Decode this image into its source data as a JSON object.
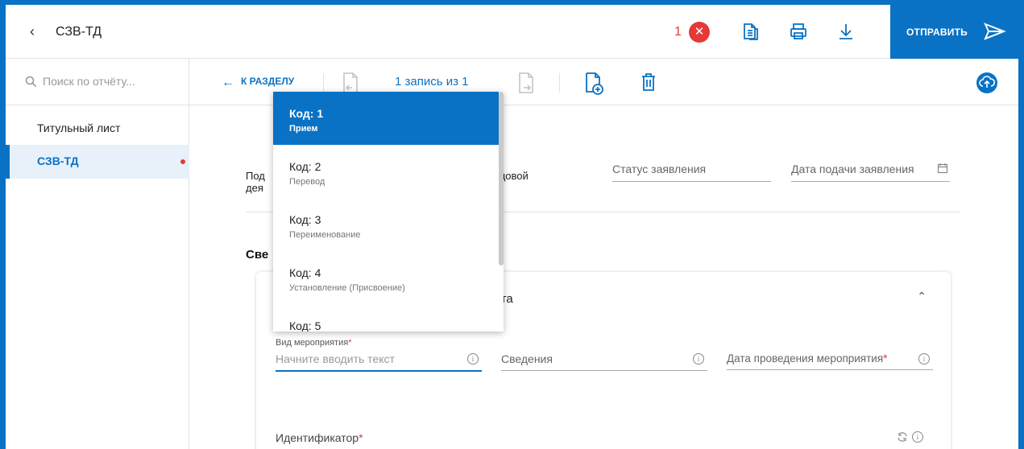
{
  "header": {
    "back_icon": "chevron-left-icon",
    "title": "СЗВ-ТД",
    "error_count": "1",
    "error_icon": "close-icon",
    "actions": [
      "copy-document-icon",
      "print-icon",
      "download-icon"
    ],
    "send_label": "ОТПРАВИТЬ",
    "send_icon": "send-icon",
    "accent": "#0a72c4",
    "error_color": "#e53935"
  },
  "sidebar": {
    "search_placeholder": "Поиск по отчёту...",
    "items": [
      {
        "label": "Титульный лист",
        "active": false
      },
      {
        "label": "СЗВ-ТД",
        "active": true,
        "has_error": true
      }
    ]
  },
  "toolbar": {
    "to_section": "К РАЗДЕЛУ",
    "record_label": "1 запись из 1"
  },
  "form": {
    "lead_label_line1": "Под",
    "lead_label_line1_tail": "й о трудовой",
    "lead_label_line2": "дея",
    "status_label": "Статус заявления",
    "date_label": "Дата подачи заявления",
    "section_title_head": "Све",
    "section_title_tail": "та",
    "card_title_tail": "чета",
    "event_type_label": "Вид мероприятия",
    "event_type_placeholder": "Начните вводить текст",
    "info_label": "Сведения",
    "event_date_label": "Дата проведения мероприятия",
    "identifier_label": "Идентификатор",
    "required_mark": "*"
  },
  "dropdown": {
    "items": [
      {
        "code": "Код: 1",
        "desc": "Прием",
        "selected": true
      },
      {
        "code": "Код: 2",
        "desc": "Перевод",
        "selected": false
      },
      {
        "code": "Код: 3",
        "desc": "Переименование",
        "selected": false
      },
      {
        "code": "Код: 4",
        "desc": "Установление (Присвоение)",
        "selected": false
      },
      {
        "code": "Код: 5",
        "desc": "",
        "selected": false
      }
    ]
  }
}
